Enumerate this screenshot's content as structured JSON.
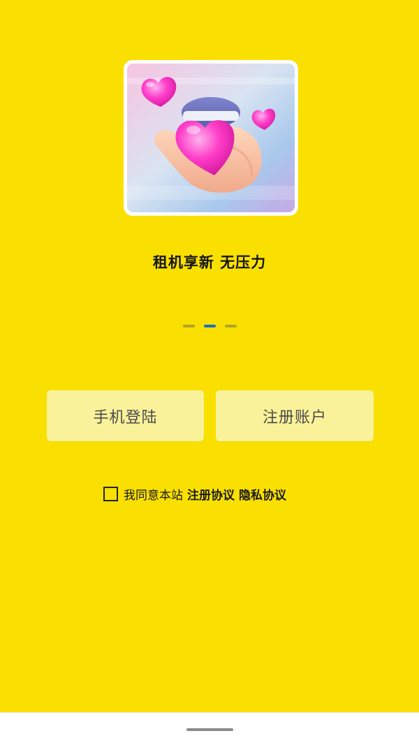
{
  "onboarding": {
    "slogan": "租机享新 无压力",
    "pager": {
      "count": 3,
      "active_index": 1
    }
  },
  "actions": {
    "login_label": "手机登陆",
    "register_label": "注册账户"
  },
  "agreement": {
    "checked": false,
    "prefix_text": "我同意本站",
    "register_agreement_label": "注册协议",
    "privacy_policy_label": "隐私协议"
  },
  "theme": {
    "background": "#fae000",
    "button_background": "#faf29a",
    "active_dot": "#1e6fc0",
    "inactive_dot": "#b3a522"
  }
}
